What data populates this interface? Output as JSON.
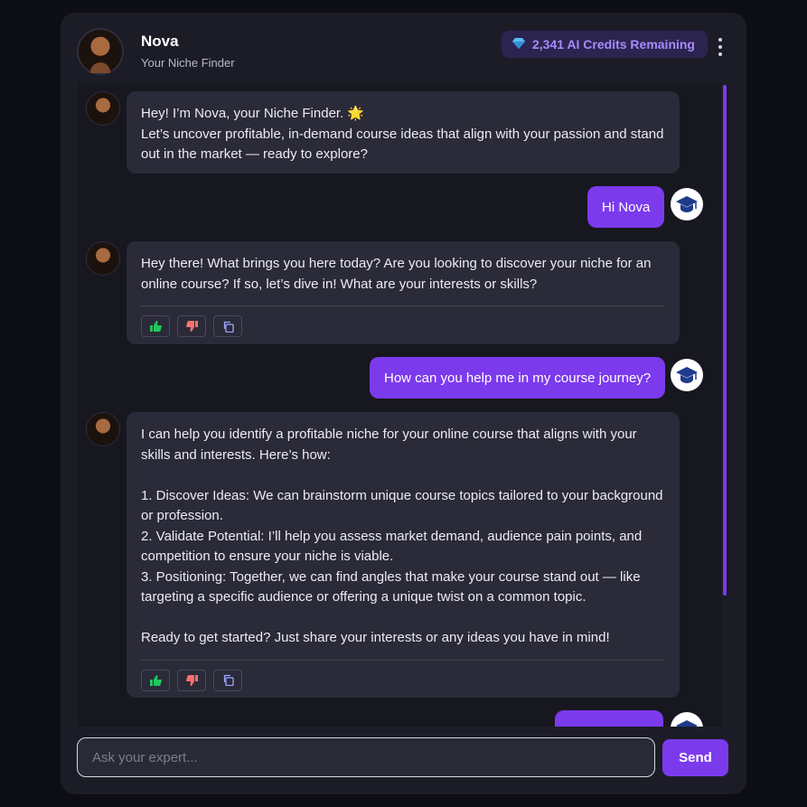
{
  "header": {
    "name": "Nova",
    "subtitle": "Your Niche Finder",
    "credits_label": "2,341 AI Credits Remaining",
    "credits_icon": "gem-icon"
  },
  "messages": [
    {
      "role": "ai",
      "text": "Hey! I’m Nova, your Niche Finder. 🌟\nLet’s uncover profitable, in-demand course ideas that align with your passion and stand out in the market — ready to explore?"
    },
    {
      "role": "user",
      "text": "Hi Nova"
    },
    {
      "role": "ai",
      "text": "Hey there! What brings you here today? Are you looking to discover your niche for an online course? If so, let’s dive in! What are your interests or skills?"
    },
    {
      "role": "user",
      "text": "How can you help me in my course journey?"
    },
    {
      "role": "ai",
      "text": "I can help you identify a profitable niche for your online course that aligns with your skills and interests. Here’s how:\n\n1. Discover Ideas: We can brainstorm unique course topics tailored to your background or profession.\n2. Validate Potential: I’ll help you assess market demand, audience pain points, and competition to ensure your niche is viable.\n3. Positioning: Together, we can find angles that make your course stand out — like targeting a specific audience or offering a unique twist on a common topic.\n\nReady to get started? Just share your interests or any ideas you have in mind!"
    }
  ],
  "composer": {
    "placeholder": "Ask your expert...",
    "send_label": "Send"
  },
  "colors": {
    "accent": "#7c3aed",
    "panel": "#1c1c27",
    "bubble_ai": "#2a2a38",
    "like": "#22c55e",
    "dislike": "#f87171"
  }
}
